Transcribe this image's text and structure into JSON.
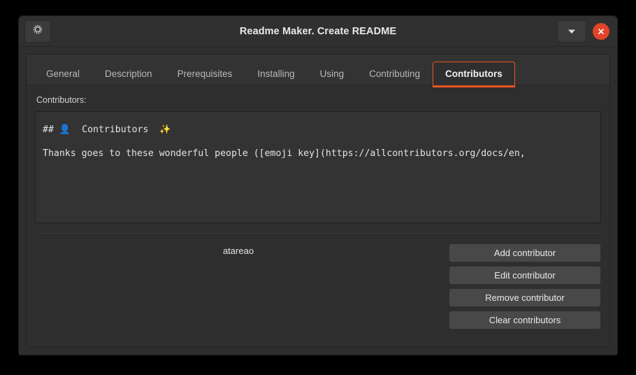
{
  "window": {
    "title": "Readme Maker. Create README",
    "menu_icon": "gear-icon",
    "dropdown_icon": "chevron-down-icon",
    "close_icon": "close-icon"
  },
  "tabs": [
    {
      "label": "General",
      "active": false
    },
    {
      "label": "Description",
      "active": false
    },
    {
      "label": "Prerequisites",
      "active": false
    },
    {
      "label": "Installing",
      "active": false
    },
    {
      "label": "Using",
      "active": false
    },
    {
      "label": "Contributing",
      "active": false
    },
    {
      "label": "Contributors",
      "active": true
    }
  ],
  "page": {
    "field_label": "Contributors:",
    "editor": {
      "line1_prefix": "## ",
      "line1_emoji_person": "👤",
      "line1_text": "  Contributors  ",
      "line1_emoji_sparkle": "✨",
      "line2": "Thanks goes to these wonderful people ([emoji key](https://allcontributors.org/docs/en,"
    },
    "contributors": [
      "atareao"
    ],
    "buttons": [
      "Add contributor",
      "Edit contributor",
      "Remove contributor",
      "Clear contributors"
    ]
  },
  "colors": {
    "accent": "#e95420",
    "close": "#e0442a",
    "window_bg": "#2e2e2e",
    "titlebar_bg": "#303030",
    "editor_bg": "#333333",
    "button_bg": "#484848",
    "emoji_person": "#3b82d6",
    "emoji_sparkle": "#f5c400"
  }
}
